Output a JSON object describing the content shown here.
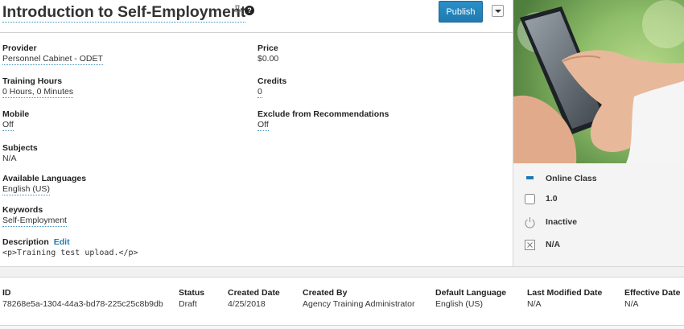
{
  "header": {
    "title": "Introduction to Self-Employment",
    "help_glyph": "?",
    "publish_label": "Publish"
  },
  "fields": {
    "provider": {
      "label": "Provider",
      "value": "Personnel Cabinet - ODET"
    },
    "price": {
      "label": "Price",
      "value": "$0.00"
    },
    "training_hours": {
      "label": "Training Hours",
      "value": "0 Hours, 0 Minutes"
    },
    "credits": {
      "label": "Credits",
      "value": "0"
    },
    "mobile": {
      "label": "Mobile",
      "value": "Off"
    },
    "exclude": {
      "label": "Exclude from Recommendations",
      "value": "Off"
    },
    "subjects": {
      "label": "Subjects",
      "value": "N/A"
    },
    "languages": {
      "label": "Available Languages",
      "value": "English (US)"
    },
    "keywords": {
      "label": "Keywords",
      "value": "Self-Employment"
    },
    "description": {
      "label": "Description",
      "edit_label": "Edit",
      "value": "<p>Training test upload.</p>"
    }
  },
  "side": {
    "type": "Online Class",
    "version": "1.0",
    "status": "Inactive",
    "other": "N/A"
  },
  "meta": {
    "id": {
      "label": "ID",
      "value": "78268e5a-1304-44a3-bd78-225c25c8b9db"
    },
    "status": {
      "label": "Status",
      "value": "Draft"
    },
    "created_date": {
      "label": "Created Date",
      "value": "4/25/2018"
    },
    "created_by": {
      "label": "Created By",
      "value": "Agency Training Administrator"
    },
    "default_language": {
      "label": "Default Language",
      "value": "English (US)"
    },
    "last_modified": {
      "label": "Last Modified Date",
      "value": "N/A"
    },
    "effective_date": {
      "label": "Effective Date",
      "value": "N/A"
    }
  },
  "colors": {
    "accent": "#1f7bb0",
    "publish_bg": "#2a8fc8",
    "panel_bg": "#f4f4f4"
  }
}
